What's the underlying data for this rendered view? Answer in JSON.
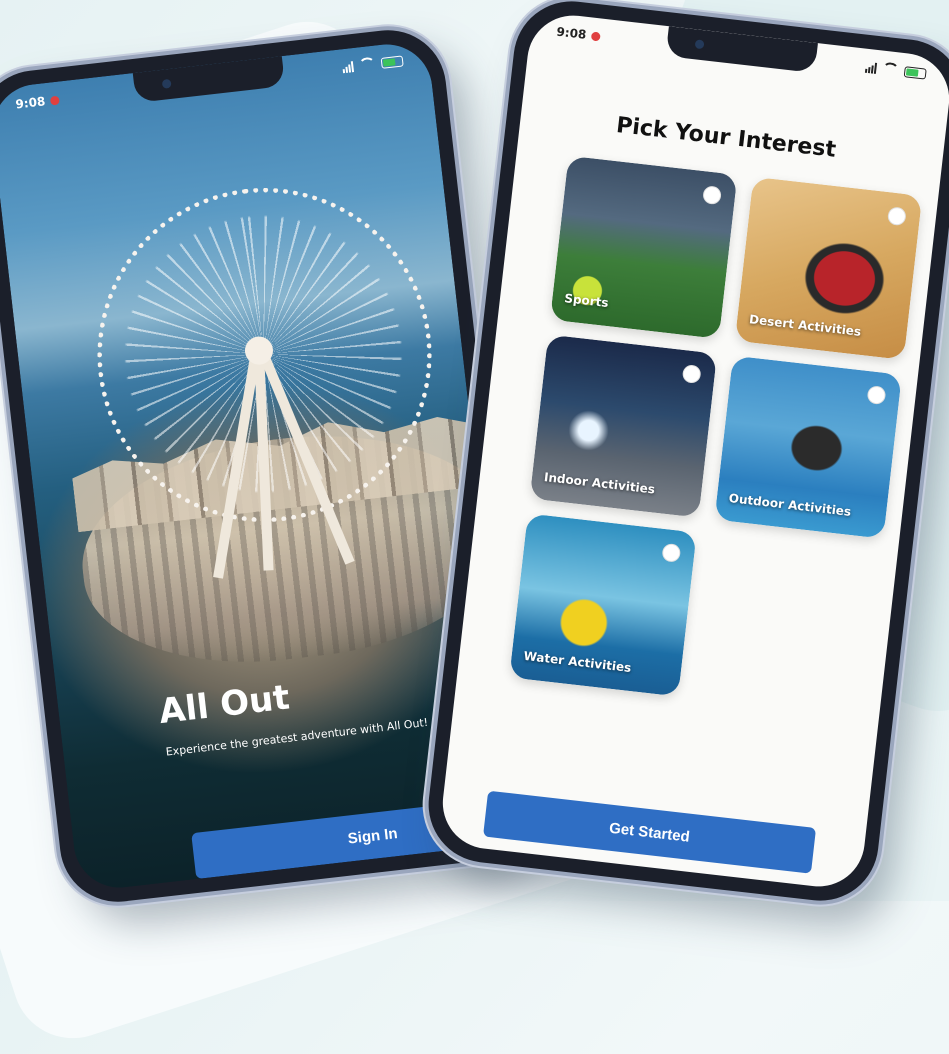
{
  "phone1": {
    "status_time": "9:08",
    "app_title": "All Out",
    "tagline": "Experience the greatest adventure with All Out!",
    "signin_label": "Sign In"
  },
  "phone2": {
    "status_time": "9:08",
    "title": "Pick Your Interest",
    "cards": [
      {
        "label": "Sports",
        "selected": false
      },
      {
        "label": "Desert Activities",
        "selected": false
      },
      {
        "label": "Indoor Activities",
        "selected": false
      },
      {
        "label": "Outdoor Activities",
        "selected": false
      },
      {
        "label": "Water Activities",
        "selected": false
      }
    ],
    "get_started_label": "Get Started"
  },
  "colors": {
    "primary_button": "#2f6ec4",
    "phone_frame": "#1b1f2a",
    "background": "#e6f2f3"
  },
  "icons": [
    "record-icon",
    "signal-icon",
    "wifi-icon",
    "battery-icon",
    "radio-icon"
  ]
}
